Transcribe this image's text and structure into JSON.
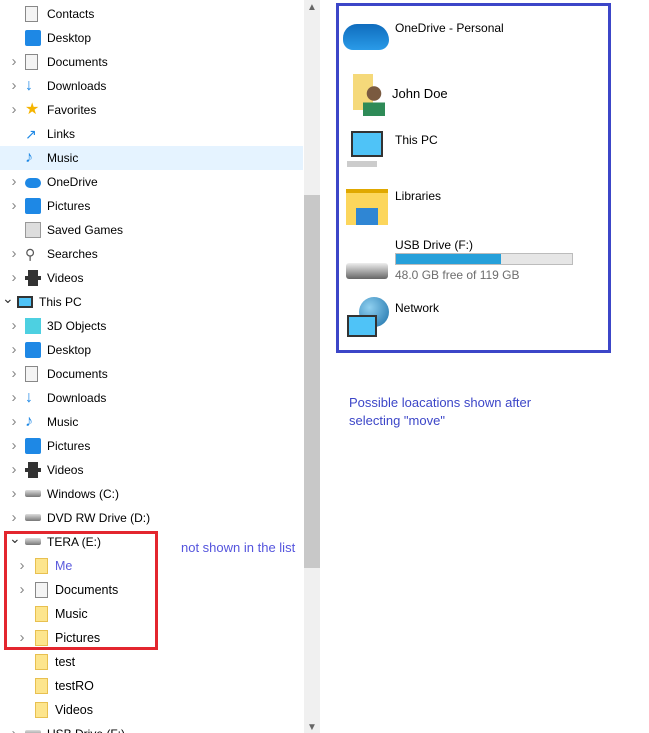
{
  "tree": [
    {
      "label": "Contacts",
      "level": 1,
      "chev": "",
      "icon": "contacts-icon",
      "cls": "doc"
    },
    {
      "label": "Desktop",
      "level": 1,
      "chev": "",
      "icon": "desktop-icon",
      "cls": "blue"
    },
    {
      "label": "Documents",
      "level": 1,
      "chev": ">",
      "icon": "documents-icon",
      "cls": "doc"
    },
    {
      "label": "Downloads",
      "level": 1,
      "chev": ">",
      "icon": "downloads-icon",
      "cls": "down",
      "glyph": "↓"
    },
    {
      "label": "Favorites",
      "level": 1,
      "chev": ">",
      "icon": "star-icon",
      "cls": "star",
      "glyph": "★"
    },
    {
      "label": "Links",
      "level": 1,
      "chev": "",
      "icon": "links-icon",
      "cls": "link",
      "glyph": "↗"
    },
    {
      "label": "Music",
      "level": 1,
      "chev": "",
      "icon": "music-icon",
      "cls": "music",
      "glyph": "♪",
      "selected": true
    },
    {
      "label": "OneDrive",
      "level": 1,
      "chev": ">",
      "icon": "onedrive-icon",
      "cls": "cloud"
    },
    {
      "label": "Pictures",
      "level": 1,
      "chev": ">",
      "icon": "pictures-icon",
      "cls": "blue"
    },
    {
      "label": "Saved Games",
      "level": 1,
      "chev": "",
      "icon": "saved-games-icon",
      "cls": "game"
    },
    {
      "label": "Searches",
      "level": 1,
      "chev": ">",
      "icon": "search-icon",
      "cls": "search",
      "glyph": "⚲"
    },
    {
      "label": "Videos",
      "level": 1,
      "chev": ">",
      "icon": "videos-icon",
      "cls": "film"
    },
    {
      "label": "This PC",
      "level": 0,
      "chev": "v",
      "icon": "this-pc-icon",
      "cls": "pc"
    },
    {
      "label": "3D Objects",
      "level": 1,
      "chev": ">",
      "icon": "3d-objects-icon",
      "cls": "cube"
    },
    {
      "label": "Desktop",
      "level": 1,
      "chev": ">",
      "icon": "desktop-icon",
      "cls": "blue"
    },
    {
      "label": "Documents",
      "level": 1,
      "chev": ">",
      "icon": "documents-icon",
      "cls": "doc"
    },
    {
      "label": "Downloads",
      "level": 1,
      "chev": ">",
      "icon": "downloads-icon",
      "cls": "down",
      "glyph": "↓"
    },
    {
      "label": "Music",
      "level": 1,
      "chev": ">",
      "icon": "music-icon",
      "cls": "music",
      "glyph": "♪"
    },
    {
      "label": "Pictures",
      "level": 1,
      "chev": ">",
      "icon": "pictures-icon",
      "cls": "blue"
    },
    {
      "label": "Videos",
      "level": 1,
      "chev": ">",
      "icon": "videos-icon",
      "cls": "film"
    },
    {
      "label": "Windows (C:)",
      "level": 1,
      "chev": ">",
      "icon": "drive-icon",
      "cls": "drive"
    },
    {
      "label": "DVD RW Drive (D:)",
      "level": 1,
      "chev": ">",
      "icon": "dvd-drive-icon",
      "cls": "drive"
    },
    {
      "label": "TERA  (E:)",
      "level": 1,
      "chev": "v",
      "icon": "drive-icon",
      "cls": "drive"
    },
    {
      "label": "Me",
      "level": 2,
      "chev": ">",
      "icon": "folder-icon",
      "cls": "folder",
      "color": "#5a5adc"
    },
    {
      "label": "Documents",
      "level": 2,
      "chev": ">",
      "icon": "documents-icon",
      "cls": "doc"
    },
    {
      "label": "Music",
      "level": 2,
      "chev": "",
      "icon": "folder-icon",
      "cls": "folder"
    },
    {
      "label": "Pictures",
      "level": 2,
      "chev": ">",
      "icon": "folder-icon",
      "cls": "folder"
    },
    {
      "label": "test",
      "level": 2,
      "chev": "",
      "icon": "folder-icon",
      "cls": "folder"
    },
    {
      "label": "testRO",
      "level": 2,
      "chev": "",
      "icon": "folder-icon",
      "cls": "folder"
    },
    {
      "label": "Videos",
      "level": 2,
      "chev": "",
      "icon": "folder-icon",
      "cls": "folder"
    },
    {
      "label": "USB Drive (F:)",
      "level": 1,
      "chev": ">",
      "icon": "drive-icon",
      "cls": "drive"
    }
  ],
  "annotation_not_shown": "not shown in the list",
  "locations": {
    "onedrive": "OneDrive - Personal",
    "user": "John Doe",
    "this_pc": "This PC",
    "libraries": "Libraries",
    "usb_name": "USB Drive (F:)",
    "usb_free": "48.0 GB free of 119 GB",
    "usb_used_fraction": 0.597,
    "network": "Network"
  },
  "annotation_possible": "Possible loacations shown after selecting \"move\"",
  "colors": {
    "red_box": "#e3262e",
    "blue_box": "#3c46c8",
    "usb_bar": "#26a0da",
    "selected": "#e5f3ff"
  }
}
